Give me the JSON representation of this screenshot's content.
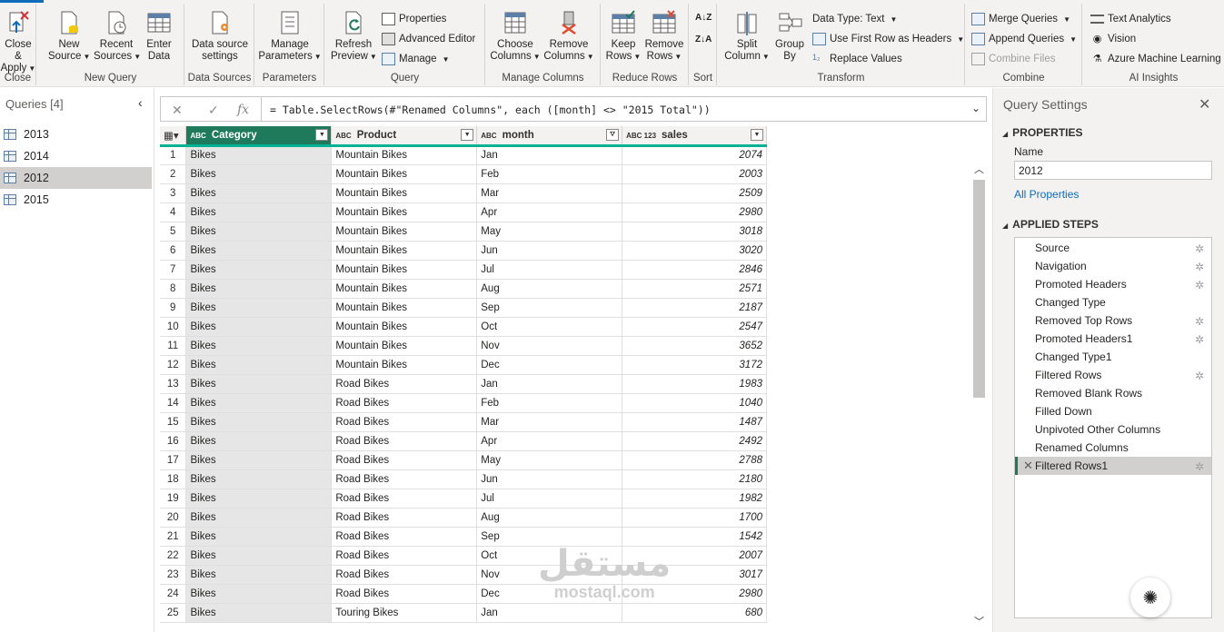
{
  "ribbon": {
    "close": {
      "close_apply": "Close &",
      "apply": "Apply",
      "group": "Close"
    },
    "new_query": {
      "new": "New",
      "source": "Source",
      "recent": "Recent",
      "sources": "Sources",
      "enter": "Enter",
      "data": "Data",
      "group": "New Query"
    },
    "data_sources": {
      "line1": "Data source",
      "line2": "settings",
      "group": "Data Sources"
    },
    "parameters": {
      "line1": "Manage",
      "line2": "Parameters",
      "group": "Parameters"
    },
    "query": {
      "refresh": "Refresh",
      "preview": "Preview",
      "properties": "Properties",
      "advanced_editor": "Advanced Editor",
      "manage": "Manage",
      "group": "Query"
    },
    "manage_columns": {
      "choose": "Choose",
      "choose2": "Columns",
      "remove": "Remove",
      "remove2": "Columns",
      "group": "Manage Columns"
    },
    "reduce_rows": {
      "keep": "Keep",
      "keep2": "Rows",
      "remove": "Remove",
      "remove2": "Rows",
      "group": "Reduce Rows"
    },
    "sort": {
      "group": "Sort"
    },
    "transform": {
      "split": "Split",
      "split2": "Column",
      "group_by": "Group",
      "group_by2": "By",
      "data_type": "Data Type: Text",
      "first_row": "Use First Row as Headers",
      "replace": "Replace Values",
      "group": "Transform"
    },
    "combine": {
      "merge": "Merge Queries",
      "append": "Append Queries",
      "combine_files": "Combine Files",
      "group": "Combine"
    },
    "ai": {
      "text": "Text Analytics",
      "vision": "Vision",
      "azure": "Azure Machine Learning",
      "group": "AI Insights"
    }
  },
  "queries": {
    "header": "Queries [4]",
    "items": [
      "2013",
      "2014",
      "2012",
      "2015"
    ],
    "selected": 2
  },
  "formula": "= Table.SelectRows(#\"Renamed Columns\", each ([month] <> \"2015 Total\"))",
  "grid": {
    "columns": [
      {
        "type": "ABC",
        "name": "Category"
      },
      {
        "type": "ABC",
        "name": "Product"
      },
      {
        "type": "ABC",
        "name": "month"
      },
      {
        "type": "ABC 123",
        "name": "sales"
      }
    ],
    "rows": [
      [
        "1",
        "Bikes",
        "Mountain Bikes",
        "Jan",
        "2074"
      ],
      [
        "2",
        "Bikes",
        "Mountain Bikes",
        "Feb",
        "2003"
      ],
      [
        "3",
        "Bikes",
        "Mountain Bikes",
        "Mar",
        "2509"
      ],
      [
        "4",
        "Bikes",
        "Mountain Bikes",
        "Apr",
        "2980"
      ],
      [
        "5",
        "Bikes",
        "Mountain Bikes",
        "May",
        "3018"
      ],
      [
        "6",
        "Bikes",
        "Mountain Bikes",
        "Jun",
        "3020"
      ],
      [
        "7",
        "Bikes",
        "Mountain Bikes",
        "Jul",
        "2846"
      ],
      [
        "8",
        "Bikes",
        "Mountain Bikes",
        "Aug",
        "2571"
      ],
      [
        "9",
        "Bikes",
        "Mountain Bikes",
        "Sep",
        "2187"
      ],
      [
        "10",
        "Bikes",
        "Mountain Bikes",
        "Oct",
        "2547"
      ],
      [
        "11",
        "Bikes",
        "Mountain Bikes",
        "Nov",
        "3652"
      ],
      [
        "12",
        "Bikes",
        "Mountain Bikes",
        "Dec",
        "3172"
      ],
      [
        "13",
        "Bikes",
        "Road Bikes",
        "Jan",
        "1983"
      ],
      [
        "14",
        "Bikes",
        "Road Bikes",
        "Feb",
        "1040"
      ],
      [
        "15",
        "Bikes",
        "Road Bikes",
        "Mar",
        "1487"
      ],
      [
        "16",
        "Bikes",
        "Road Bikes",
        "Apr",
        "2492"
      ],
      [
        "17",
        "Bikes",
        "Road Bikes",
        "May",
        "2788"
      ],
      [
        "18",
        "Bikes",
        "Road Bikes",
        "Jun",
        "2180"
      ],
      [
        "19",
        "Bikes",
        "Road Bikes",
        "Jul",
        "1982"
      ],
      [
        "20",
        "Bikes",
        "Road Bikes",
        "Aug",
        "1700"
      ],
      [
        "21",
        "Bikes",
        "Road Bikes",
        "Sep",
        "1542"
      ],
      [
        "22",
        "Bikes",
        "Road Bikes",
        "Oct",
        "2007"
      ],
      [
        "23",
        "Bikes",
        "Road Bikes",
        "Nov",
        "3017"
      ],
      [
        "24",
        "Bikes",
        "Road Bikes",
        "Dec",
        "2980"
      ],
      [
        "25",
        "Bikes",
        "Touring Bikes",
        "Jan",
        "680"
      ]
    ]
  },
  "settings": {
    "title": "Query Settings",
    "properties": "PROPERTIES",
    "name_label": "Name",
    "name_value": "2012",
    "all_properties": "All Properties",
    "applied_steps": "APPLIED STEPS",
    "steps": [
      {
        "name": "Source",
        "gear": true
      },
      {
        "name": "Navigation",
        "gear": true
      },
      {
        "name": "Promoted Headers",
        "gear": true
      },
      {
        "name": "Changed Type",
        "gear": false
      },
      {
        "name": "Removed Top Rows",
        "gear": true
      },
      {
        "name": "Promoted Headers1",
        "gear": true
      },
      {
        "name": "Changed Type1",
        "gear": false
      },
      {
        "name": "Filtered Rows",
        "gear": true
      },
      {
        "name": "Removed Blank Rows",
        "gear": false
      },
      {
        "name": "Filled Down",
        "gear": false
      },
      {
        "name": "Unpivoted Other Columns",
        "gear": false
      },
      {
        "name": "Renamed Columns",
        "gear": false
      },
      {
        "name": "Filtered Rows1",
        "gear": true
      }
    ],
    "selected_step": 12
  },
  "watermark": {
    "arabic": "مستقل",
    "latin": "mostaql.com"
  },
  "colors": {
    "accent": "#1f7a5c",
    "teal": "#00b294",
    "link": "#0f6cbd"
  }
}
